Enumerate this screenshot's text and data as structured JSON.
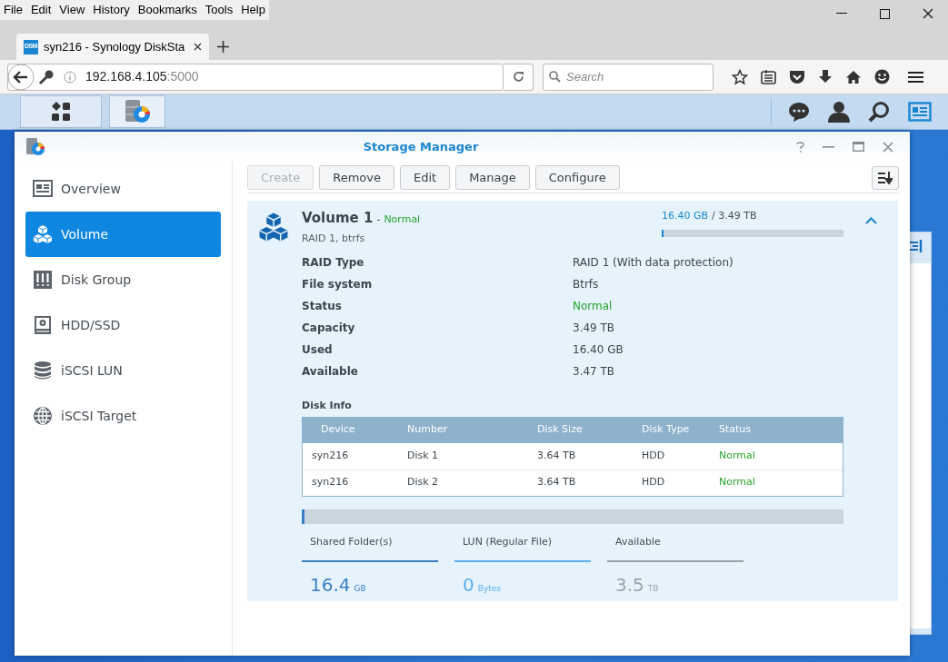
{
  "browser": {
    "menu": [
      "File",
      "Edit",
      "View",
      "History",
      "Bookmarks",
      "Tools",
      "Help"
    ],
    "tab": {
      "favicon": "DSM",
      "title": "syn216 - Synology DiskSta"
    },
    "address": {
      "host": "192.168.4.105",
      "port": ":5000"
    },
    "search": {
      "placeholder": "Search"
    }
  },
  "storage_manager": {
    "title": "Storage Manager",
    "sidebar": [
      {
        "label": "Overview",
        "kind": "overview",
        "selected": false
      },
      {
        "label": "Volume",
        "kind": "volume",
        "selected": true
      },
      {
        "label": "Disk Group",
        "kind": "diskgroup",
        "selected": false
      },
      {
        "label": "HDD/SSD",
        "kind": "hdd",
        "selected": false
      },
      {
        "label": "iSCSI LUN",
        "kind": "lun",
        "selected": false
      },
      {
        "label": "iSCSI Target",
        "kind": "target",
        "selected": false
      }
    ],
    "toolbar": [
      {
        "label": "Create",
        "disabled": true
      },
      {
        "label": "Remove",
        "disabled": false
      },
      {
        "label": "Edit",
        "disabled": false
      },
      {
        "label": "Manage",
        "disabled": false
      },
      {
        "label": "Configure",
        "disabled": false
      }
    ],
    "volume": {
      "name": "Volume 1",
      "separator": "-",
      "status": "Normal",
      "subtitle": "RAID 1, btrfs",
      "used": "16.40 GB",
      "total": "/ 3.49 TB",
      "level": 0.005,
      "expanded": true,
      "properties": [
        {
          "label": "RAID Type",
          "value": "RAID 1 (With data protection)",
          "kind": "plain"
        },
        {
          "label": "File system",
          "value": "Btrfs",
          "kind": "plain"
        },
        {
          "label": "Status",
          "value": "Normal",
          "kind": "ok"
        },
        {
          "label": "Capacity",
          "value": "3.49 TB",
          "kind": "plain"
        },
        {
          "label": "Used",
          "value": "16.40 GB",
          "kind": "plain"
        },
        {
          "label": "Available",
          "value": "3.47 TB",
          "kind": "plain"
        }
      ],
      "disk_info": {
        "title": "Disk Info",
        "columns": [
          "Device",
          "Number",
          "Disk Size",
          "Disk Type",
          "Status"
        ],
        "rows": [
          [
            "syn216",
            "Disk 1",
            "3.64 TB",
            "HDD",
            "Normal"
          ],
          [
            "syn216",
            "Disk 2",
            "3.64 TB",
            "HDD",
            "Normal"
          ]
        ]
      },
      "usage_bar": {
        "level": 0.004
      },
      "stats": [
        {
          "label": "Shared Folder(s)",
          "value": "16.4",
          "unit": "GB",
          "color": "#3a7fc6"
        },
        {
          "label": "LUN (Regular File)",
          "value": "0",
          "unit": "Bytes",
          "color": "#5aaff0"
        },
        {
          "label": "Available",
          "value": "3.5",
          "unit": "TB",
          "color": "#9aa3aa"
        }
      ]
    }
  }
}
